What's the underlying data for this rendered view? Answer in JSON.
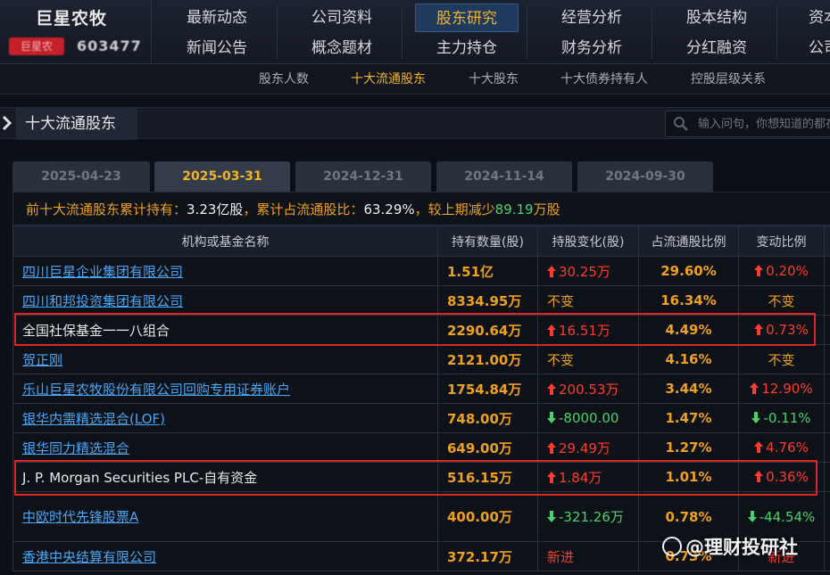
{
  "brand": {
    "name": "巨星农牧",
    "tag": "巨星农",
    "code": "603477"
  },
  "nav": {
    "row1": [
      "最新动态",
      "公司资料",
      "股东研究",
      "经营分析",
      "股本结构",
      "资本运作"
    ],
    "row2": [
      "新闻公告",
      "概念题材",
      "主力持仓",
      "财务分析",
      "分红融资",
      "公司大事"
    ]
  },
  "subnav": [
    "股东人数",
    "十大流通股东",
    "十大股东",
    "十大债券持有人",
    "控股层级关系"
  ],
  "section": {
    "title": "十大流通股东",
    "search_placeholder": "输入问句，你想知道的都在这里"
  },
  "tabs": [
    "2025-04-23",
    "2025-03-31",
    "2024-12-31",
    "2024-11-14",
    "2024-09-30"
  ],
  "summary": {
    "label1": "前十大流通股东累计持有：",
    "value1": "3.23亿股",
    "label2": "，累计占流通股比：",
    "value2": "63.29%",
    "label3": "，较上期减少",
    "value3": "89.19",
    "label4": "万股"
  },
  "table": {
    "headers": [
      "机构或基金名称",
      "持有数量(股)",
      "持股变化(股)",
      "占流通股比例",
      "变动比例"
    ],
    "rows": [
      {
        "name": "四川巨星企业集团有限公司",
        "hold": "1.51亿",
        "change": "30.25万",
        "ratio": "29.60%",
        "pct": "0.20%"
      },
      {
        "name": "四川和邦投资集团有限公司",
        "hold": "8334.95万",
        "change": "不变",
        "ratio": "16.34%",
        "pct": "不变"
      },
      {
        "name": "全国社保基金一一八组合",
        "hold": "2290.64万",
        "change": "16.51万",
        "ratio": "4.49%",
        "pct": "0.73%"
      },
      {
        "name": "贺正刚",
        "hold": "2121.00万",
        "change": "不变",
        "ratio": "4.16%",
        "pct": "不变"
      },
      {
        "name": "乐山巨星农牧股份有限公司回购专用证券账户",
        "hold": "1754.84万",
        "change": "200.53万",
        "ratio": "3.44%",
        "pct": "12.90%"
      },
      {
        "name": "银华内需精选混合(LOF)",
        "hold": "748.00万",
        "change": "-8000.00",
        "ratio": "1.47%",
        "pct": "-0.11%"
      },
      {
        "name": "银华同力精选混合",
        "hold": "649.00万",
        "change": "29.49万",
        "ratio": "1.27%",
        "pct": "4.76%"
      },
      {
        "name": "J. P. Morgan Securities PLC-自有资金",
        "hold": "516.15万",
        "change": "1.84万",
        "ratio": "1.01%",
        "pct": "0.36%"
      },
      {
        "name": "中欧时代先锋股票A",
        "hold": "400.00万",
        "change": "-321.26万",
        "ratio": "0.78%",
        "pct": "-44.54%"
      },
      {
        "name": "香港中央结算有限公司",
        "hold": "372.17万",
        "change": "新进",
        "ratio": "0.73%",
        "pct": "新进"
      }
    ]
  },
  "watermark": "@理财投研社",
  "colors": {
    "accent": "#f0b429",
    "up": "#ff3b30",
    "down": "#4bd16c",
    "link": "#4ba6f5",
    "highlight": "#e02424"
  }
}
